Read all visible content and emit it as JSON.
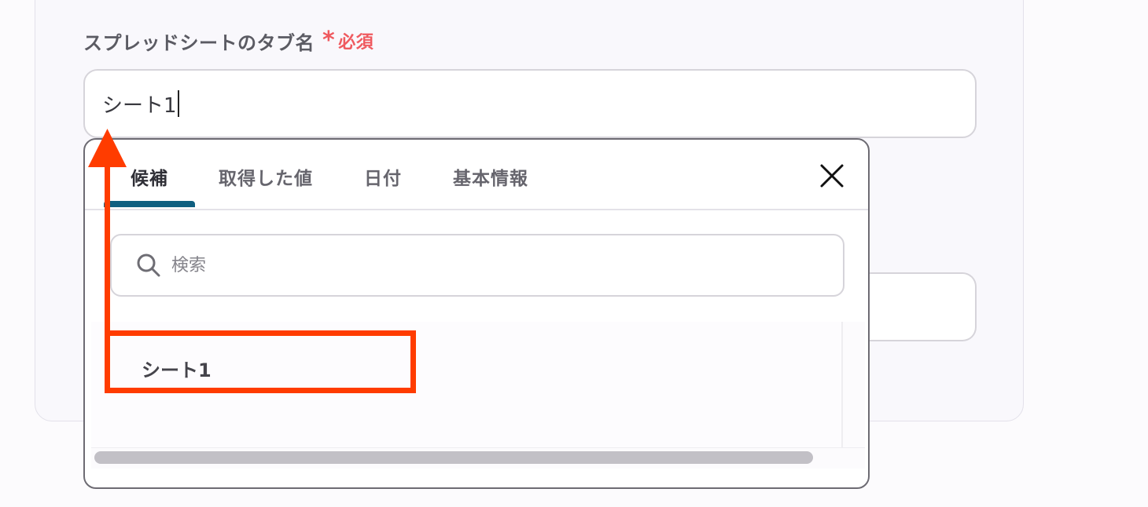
{
  "field": {
    "label": "スプレッドシートのタブ名",
    "required_mark": "*",
    "required_text": "必須",
    "value": "シート1"
  },
  "popup": {
    "tabs": [
      {
        "label": "候補",
        "active": true
      },
      {
        "label": "取得した値",
        "active": false
      },
      {
        "label": "日付",
        "active": false
      },
      {
        "label": "基本情報",
        "active": false
      }
    ],
    "search_placeholder": "検索",
    "items": [
      {
        "label": "シート1"
      }
    ]
  },
  "icons": {
    "close": "close-icon",
    "search": "search-icon",
    "annotation_arrow": "arrow-up-icon"
  },
  "colors": {
    "accent_tab": "#0f5f80",
    "required": "#ef5a5f",
    "annotation": "#ff3c00"
  }
}
